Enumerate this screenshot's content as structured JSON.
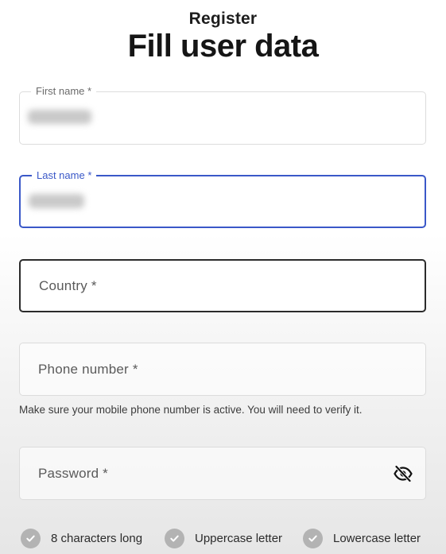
{
  "header": {
    "subtitle": "Register",
    "title": "Fill user data"
  },
  "form": {
    "first_name": {
      "label": "First name *",
      "value": "••••••"
    },
    "last_name": {
      "label": "Last name *",
      "value": "•••••"
    },
    "country": {
      "placeholder": "Country *"
    },
    "phone": {
      "placeholder": "Phone number *",
      "helper": "Make sure your mobile phone number is active. You will need to verify it."
    },
    "password": {
      "placeholder": "Password *",
      "visibility_icon": "eye-off-icon"
    }
  },
  "password_requirements": [
    {
      "label": "8 characters long",
      "icon": "check-circle-icon"
    },
    {
      "label": "Uppercase letter",
      "icon": "check-circle-icon"
    },
    {
      "label": "Lowercase letter",
      "icon": "check-circle-icon"
    }
  ],
  "colors": {
    "accent": "#3a58c8",
    "focused_dark_border": "#2b2b2b",
    "check_inactive": "#b3b3b3"
  }
}
